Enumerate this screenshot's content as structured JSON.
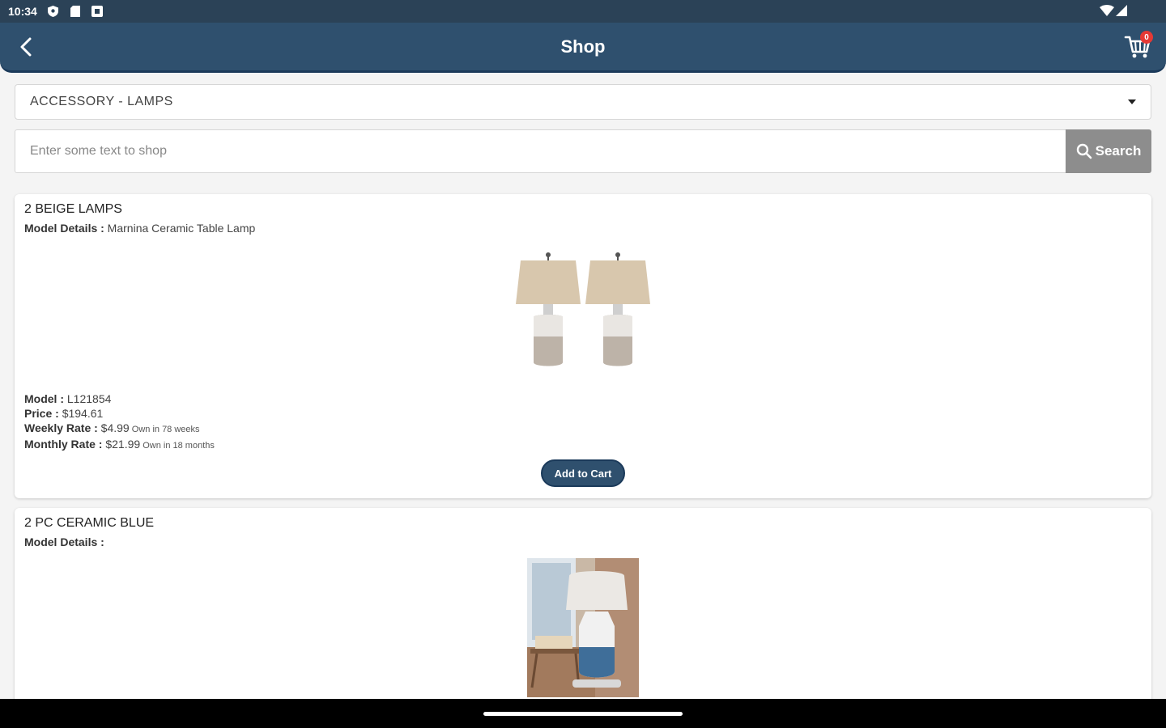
{
  "status_bar": {
    "time": "10:34",
    "left_icons": [
      "shield-icon",
      "sd-card-icon",
      "notification-icon"
    ],
    "right_icons": [
      "wifi-icon",
      "cellular-signal-icon"
    ]
  },
  "app_bar": {
    "title": "Shop",
    "cart_count": "0",
    "icons": [
      "back-arrow-icon",
      "cart-icon"
    ]
  },
  "category": {
    "selected": "ACCESSORY - LAMPS"
  },
  "search": {
    "placeholder": "Enter some text to shop",
    "button_label": "Search"
  },
  "products": [
    {
      "name": "2 BEIGE LAMPS",
      "details_label": "Model Details :",
      "details_value": " Marnina Ceramic Table Lamp",
      "model_label": "Model :",
      "model_value": " L121854",
      "price_label": "Price :",
      "price_value": " $194.61",
      "weekly_label": "Weekly Rate :",
      "weekly_value": " $4.99",
      "weekly_note": " Own in 78 weeks",
      "monthly_label": "Monthly Rate :",
      "monthly_value": " $21.99",
      "monthly_note": " Own in 18 months",
      "button_label": "Add to Cart"
    },
    {
      "name": "2 PC CERAMIC BLUE",
      "details_label": "Model Details :",
      "details_value": ""
    }
  ],
  "colors": {
    "primary": "#2f506e",
    "status_bar": "#2b4257",
    "search_button": "#8d8d8d",
    "badge": "#e53935"
  }
}
